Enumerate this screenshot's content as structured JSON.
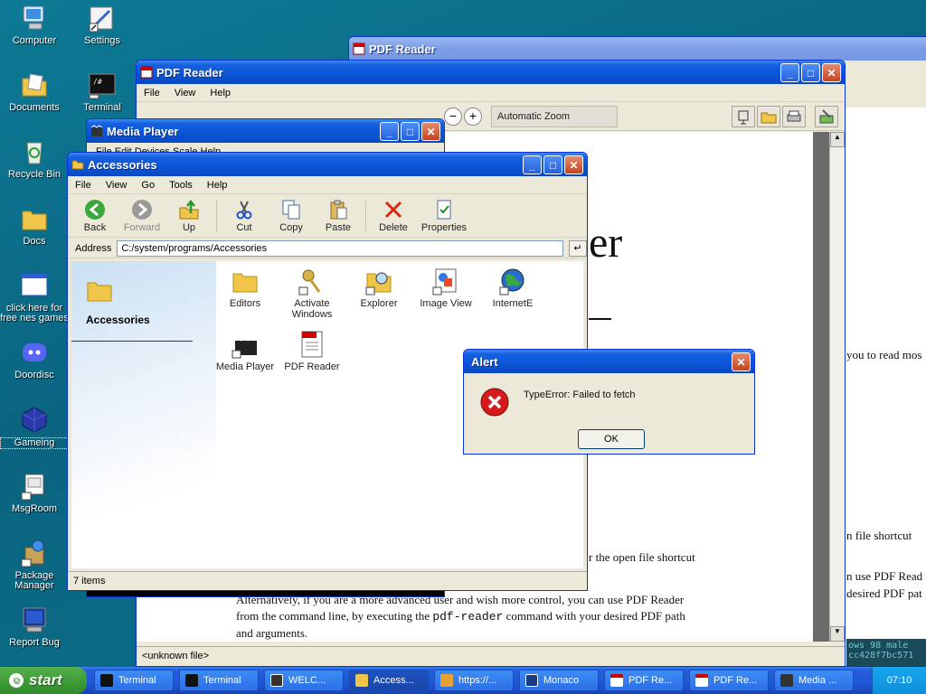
{
  "desktop": {
    "icons": [
      {
        "label": "Computer"
      },
      {
        "label": "Settings"
      },
      {
        "label": "Documents"
      },
      {
        "label": "Terminal"
      },
      {
        "label": "Recycle Bin"
      },
      {
        "label": "Docs"
      },
      {
        "label": "click here for free nes games"
      },
      {
        "label": "Doordisc"
      },
      {
        "label": "Gameing"
      },
      {
        "label": "MsgRoom"
      },
      {
        "label": "Package Manager"
      },
      {
        "label": "Report Bug"
      }
    ]
  },
  "pdf_back": {
    "title": "PDF Reader",
    "text1": "you to read mos",
    "text2": "n file shortcut",
    "text3": "n use PDF Read",
    "text4": "desired PDF pat",
    "hash1": "ows 98 male",
    "hash2": "cc428f7bc571"
  },
  "pdf_front": {
    "title": "PDF Reader",
    "menu": [
      "File",
      "View",
      "Help"
    ],
    "zoom_label": "Automatic Zoom",
    "big_text": "er",
    "small_text": "r the open file shortcut",
    "para_line1": "Alternatively, if you are a more advanced user and wish more control, you can use PDF Reader",
    "para_line2": "from the command line, by executing the ",
    "code": "pdf-reader",
    "para_line2b": " command with your desired PDF path",
    "para_line3": "and arguments.",
    "status": "<unknown file>"
  },
  "media_player": {
    "title": "Media Player",
    "menu": "File  Edit  Devices  Scale  Help"
  },
  "explorer": {
    "title": "Accessories",
    "menu": [
      "File",
      "View",
      "Go",
      "Tools",
      "Help"
    ],
    "toolbar": [
      "Back",
      "Forward",
      "Up",
      "Cut",
      "Copy",
      "Paste",
      "Delete",
      "Properties"
    ],
    "address_label": "Address",
    "address_value": "C:/system/programs/Accessories",
    "side_title": "Accessories",
    "items": [
      {
        "label": "Editors"
      },
      {
        "label": "Activate Windows"
      },
      {
        "label": "Explorer"
      },
      {
        "label": "Image View"
      },
      {
        "label": "InternetE"
      },
      {
        "label": "Media Player"
      },
      {
        "label": "PDF Reader"
      }
    ],
    "status": "7 items"
  },
  "alert": {
    "title": "Alert",
    "message": "TypeError: Failed to fetch",
    "ok": "OK"
  },
  "taskbar": {
    "start": "start",
    "tasks": [
      "Terminal",
      "Terminal",
      "WELC...",
      "Access...",
      "https://...",
      "Monaco",
      "PDF Re...",
      "PDF Re...",
      "Media ..."
    ],
    "clock": "07:10"
  }
}
